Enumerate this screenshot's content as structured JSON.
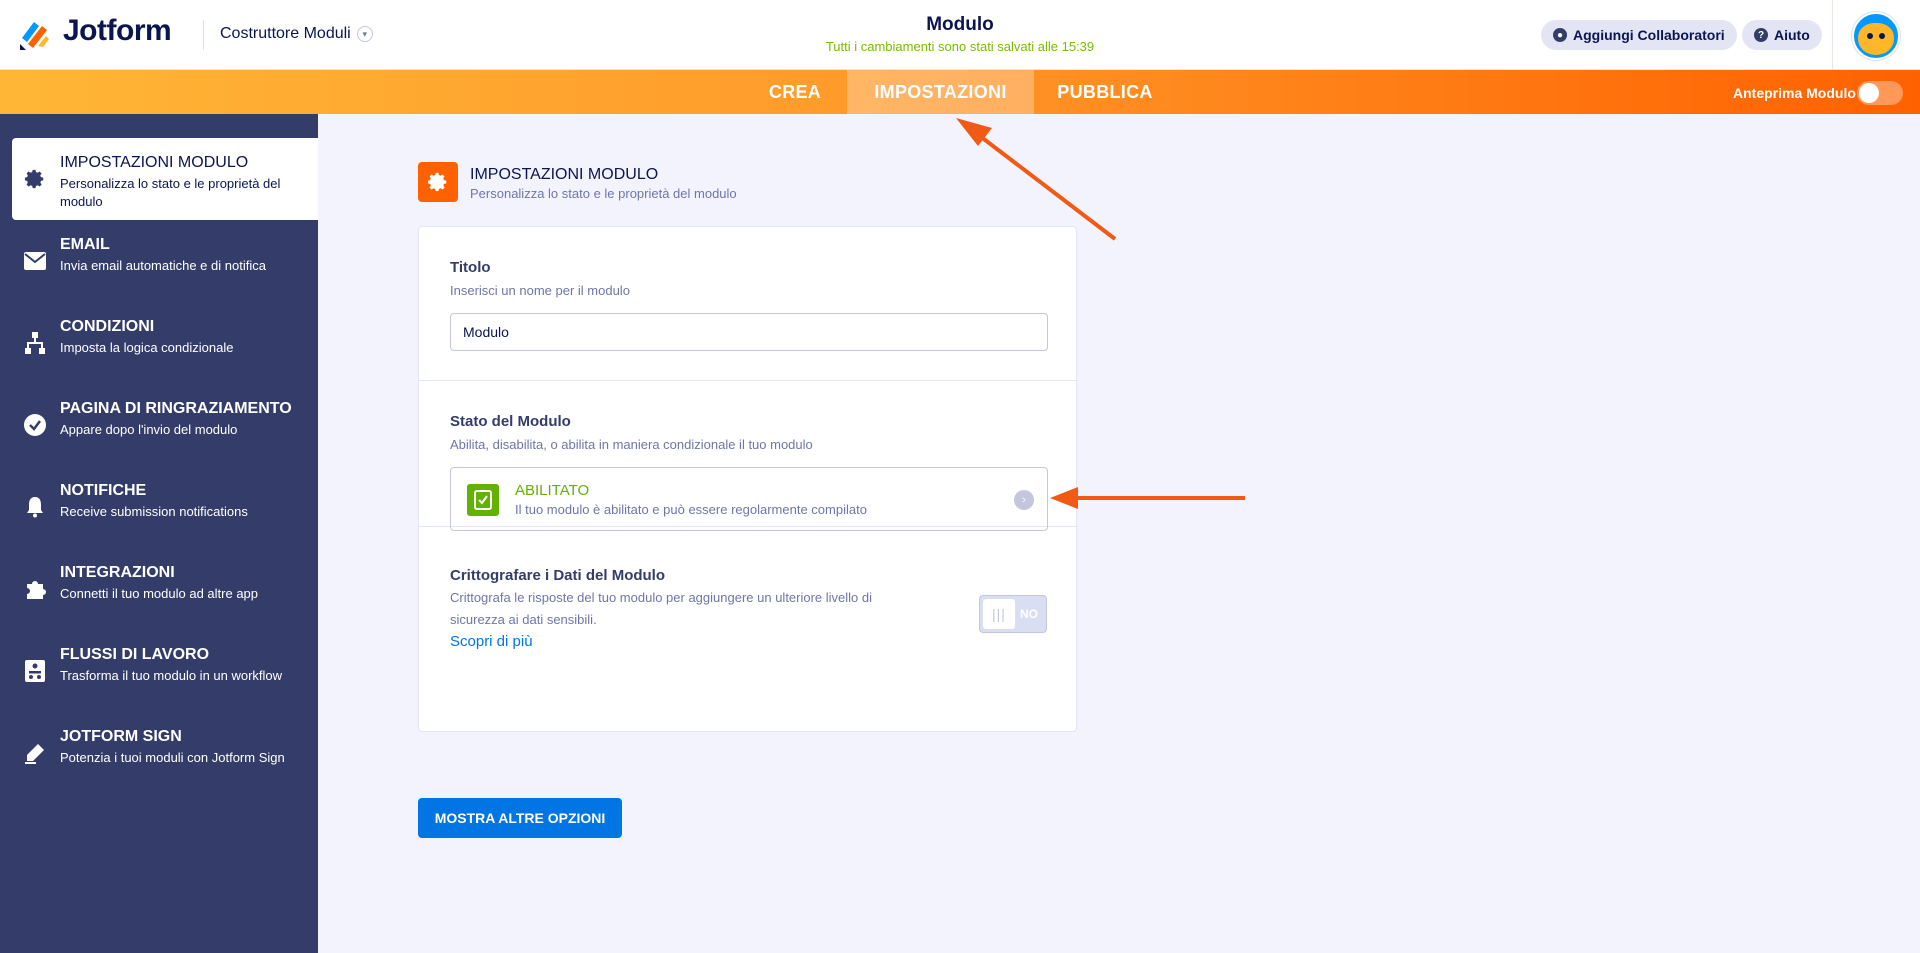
{
  "header": {
    "brand": "Jotform",
    "builder_label": "Costruttore Moduli",
    "form_title": "Modulo",
    "save_status": "Tutti i cambiamenti sono stati salvati alle 15:39",
    "collaborators_label": "Aggiungi Collaboratori",
    "help_label": "Aiuto"
  },
  "nav": {
    "tabs": [
      {
        "label": "CREA"
      },
      {
        "label": "IMPOSTAZIONI",
        "active": true
      },
      {
        "label": "PUBBLICA"
      }
    ],
    "preview_label": "Anteprima Modulo"
  },
  "sidebar": {
    "items": [
      {
        "title": "IMPOSTAZIONI MODULO",
        "desc": "Personalizza lo stato e le proprietà del modulo",
        "icon": "gear-icon",
        "active": true
      },
      {
        "title": "EMAIL",
        "desc": "Invia email automatiche e di notifica",
        "icon": "envelope-icon"
      },
      {
        "title": "CONDIZIONI",
        "desc": "Imposta la logica condizionale",
        "icon": "sitemap-icon"
      },
      {
        "title": "PAGINA DI RINGRAZIAMENTO",
        "desc": "Appare dopo l'invio del modulo",
        "icon": "check-circle-icon"
      },
      {
        "title": "NOTIFICHE",
        "desc": "Receive submission notifications",
        "icon": "bell-icon"
      },
      {
        "title": "INTEGRAZIONI",
        "desc": "Connetti il tuo modulo ad altre app",
        "icon": "puzzle-icon"
      },
      {
        "title": "FLUSSI DI LAVORO",
        "desc": "Trasforma il tuo modulo in un workflow",
        "icon": "workflow-icon"
      },
      {
        "title": "JOTFORM SIGN",
        "desc": "Potenzia i tuoi moduli con Jotform Sign",
        "icon": "pen-icon"
      }
    ]
  },
  "main": {
    "section_title": "IMPOSTAZIONI MODULO",
    "section_desc": "Personalizza lo stato e le proprietà del modulo",
    "title_field": {
      "label": "Titolo",
      "help": "Inserisci un nome per il modulo",
      "value": "Modulo"
    },
    "status": {
      "label": "Stato del Modulo",
      "help": "Abilita, disabilita, o abilita in maniera condizionale il tuo modulo",
      "value": "ABILITATO",
      "value_desc": "Il tuo modulo è abilitato e può essere regolarmente compilato"
    },
    "encrypt": {
      "label": "Crittografare i Dati del Modulo",
      "help_line1": "Crittografa le risposte del tuo modulo per aggiungere un ulteriore livello di",
      "help_line2": "sicurezza ai dati sensibili.",
      "link": "Scopri di più",
      "toggle_label": "NO"
    },
    "more_button": "MOSTRA ALTRE OPZIONI"
  },
  "colors": {
    "accent_orange": "#ff6100",
    "sidebar_bg": "#343c6a",
    "enabled_green": "#64b200",
    "primary_blue": "#0075e3",
    "annotation_arrow": "#f05a14"
  }
}
